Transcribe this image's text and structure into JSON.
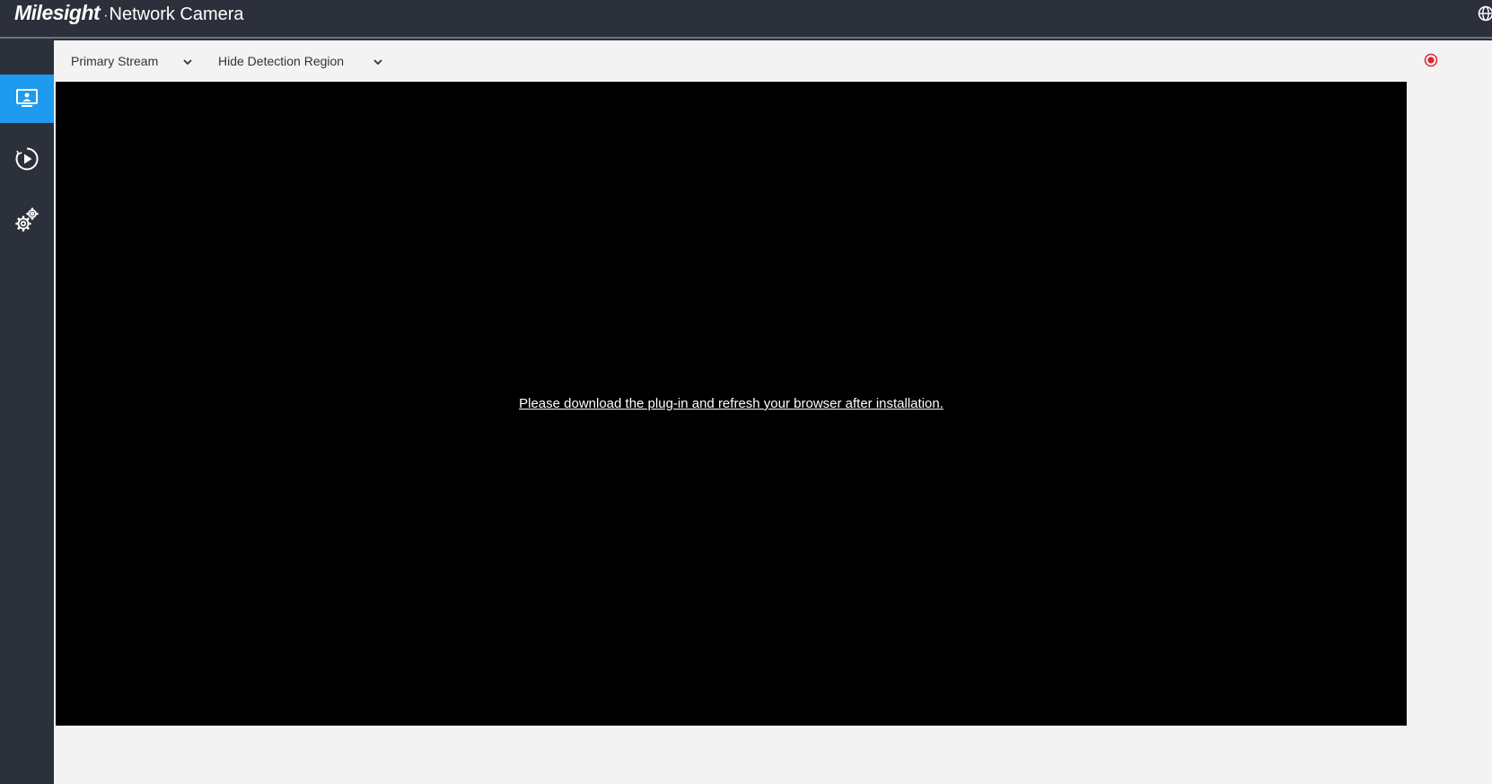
{
  "header": {
    "brand_name": "Milesight",
    "product_name": "Network Camera"
  },
  "sidebar": {
    "items": [
      {
        "name": "live-view",
        "icon": "monitor-icon",
        "active": true
      },
      {
        "name": "playback",
        "icon": "play-circle-icon",
        "active": false
      },
      {
        "name": "settings",
        "icon": "gears-icon",
        "active": false
      }
    ]
  },
  "toolbar": {
    "stream_select": "Primary Stream",
    "detection_select": "Hide Detection Region",
    "record_icon": "record-icon"
  },
  "video": {
    "plugin_message": "Please download the plug-in and refresh your browser after installation."
  },
  "colors": {
    "topbar_bg": "#2b303a",
    "active_accent": "#1e9bef",
    "record_red": "#e0232f",
    "toolbar_bg": "#f3f3f3"
  }
}
